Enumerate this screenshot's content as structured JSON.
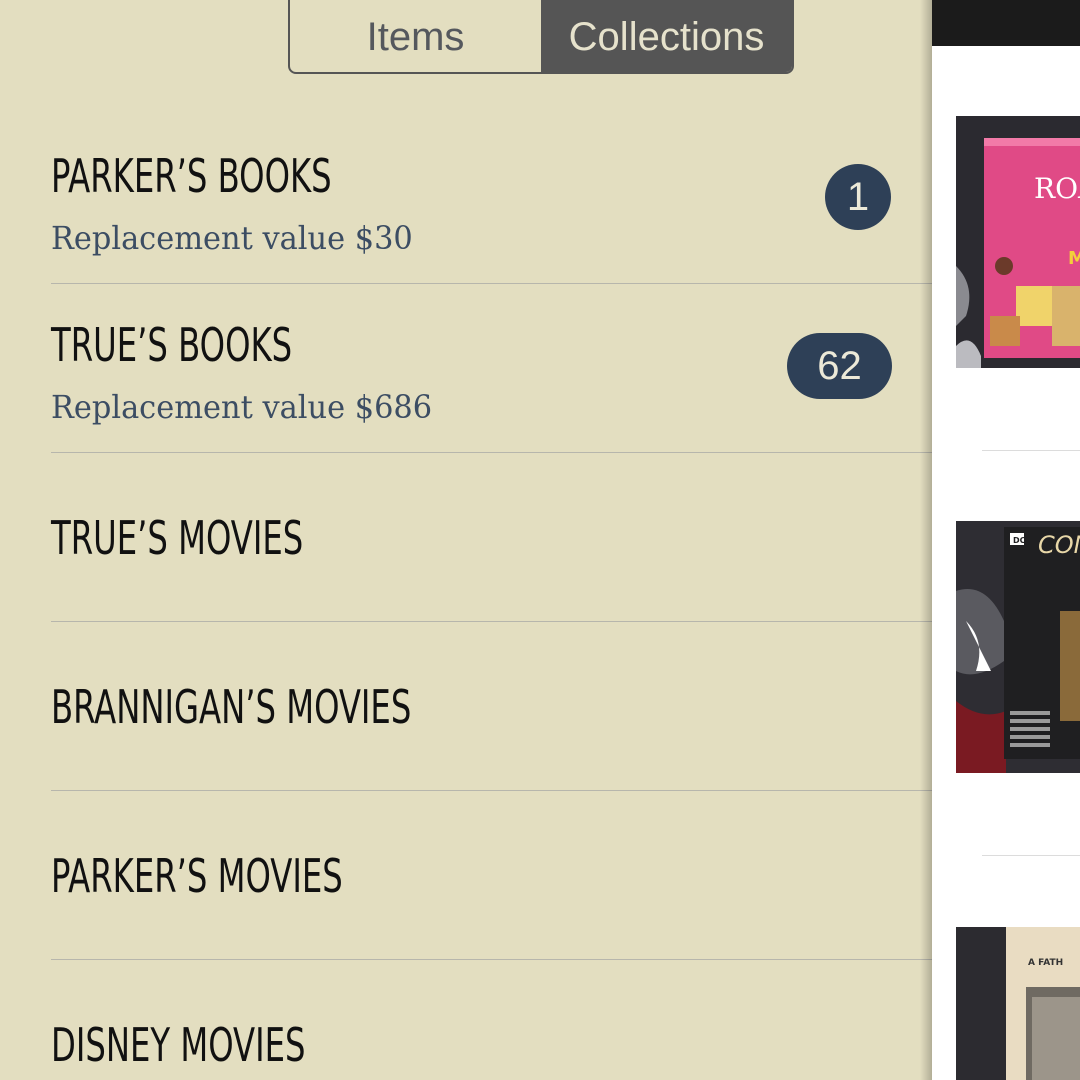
{
  "tabs": {
    "items": "Items",
    "collections": "Collections",
    "selected": "Collections"
  },
  "collections": [
    {
      "name": "PARKER’S BOOKS",
      "subtitle": "Replacement value $30",
      "count": "1"
    },
    {
      "name": "TRUE’S BOOKS",
      "subtitle": "Replacement value $686",
      "count": "62"
    },
    {
      "name": "TRUE’S MOVIES"
    },
    {
      "name": "BRANNIGAN’S MOVIES"
    },
    {
      "name": "PARKER’S MOVIES"
    },
    {
      "name": "DISNEY MOVIES"
    }
  ],
  "thumbnails": {
    "book1": {
      "cover_text": "ROA DA",
      "subtitle_text": "MAT"
    },
    "book2": {
      "publisher": "DC",
      "cover_text": "CON"
    },
    "book3": {
      "cover_text": "A FATH"
    }
  },
  "colors": {
    "background": "#e3dec0",
    "badge": "#2e4057",
    "subtitle": "#3c4d63",
    "segment_selected": "#555555"
  }
}
